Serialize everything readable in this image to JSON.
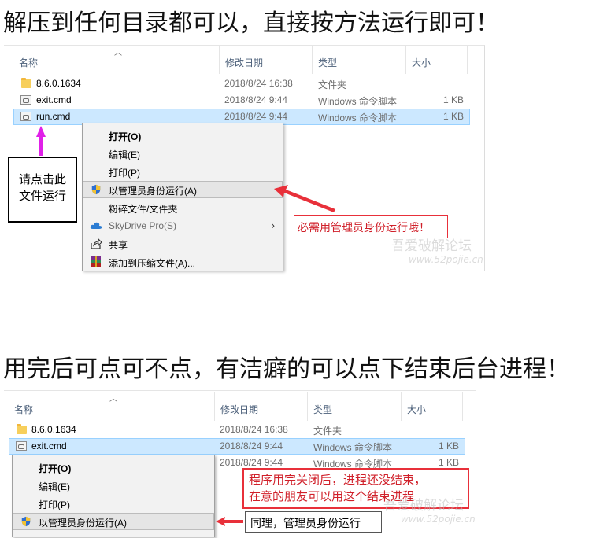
{
  "headings": {
    "top": "解压到任何目录都可以，直接按方法运行即可！",
    "bottom": "用完后可点可不点，有洁癖的可以点下结束后台进程！"
  },
  "columns": {
    "name": "名称",
    "modified": "修改日期",
    "type": "类型",
    "size": "大小"
  },
  "files": [
    {
      "name": "8.6.0.1634",
      "modified": "2018/8/24 16:38",
      "type": "文件夹",
      "size": "",
      "icon": "folder-icon"
    },
    {
      "name": "exit.cmd",
      "modified": "2018/8/24 9:44",
      "type": "Windows 命令脚本",
      "size": "1 KB",
      "icon": "cmd-file-icon"
    },
    {
      "name": "run.cmd",
      "modified": "2018/8/24 9:44",
      "type": "Windows 命令脚本",
      "size": "1 KB",
      "icon": "cmd-file-icon"
    }
  ],
  "context_menu_top": {
    "items": [
      {
        "label": "打开(O)",
        "bold": true,
        "icon": ""
      },
      {
        "label": "编辑(E)",
        "icon": ""
      },
      {
        "label": "打印(P)",
        "icon": ""
      },
      {
        "label": "以管理员身份运行(A)",
        "icon": "uac-shield-icon",
        "highlighted": true
      },
      {
        "label": "粉碎文件/文件夹",
        "icon": ""
      },
      {
        "label": "SkyDrive Pro(S)",
        "icon": "cloud-icon",
        "disabled": true,
        "submenu": true
      },
      {
        "label": "共享",
        "icon": "share-icon"
      },
      {
        "label": "添加到压缩文件(A)...",
        "icon": "winrar-icon"
      }
    ]
  },
  "context_menu_bottom": {
    "items": [
      {
        "label": "打开(O)",
        "bold": true
      },
      {
        "label": "编辑(E)"
      },
      {
        "label": "打印(P)"
      },
      {
        "label": "以管理员身份运行(A)",
        "icon": "uac-shield-icon",
        "highlighted": true
      }
    ]
  },
  "annotations": {
    "click_here_line1": "请点击此",
    "click_here_line2": "文件运行",
    "must_admin": "必需用管理员身份运行哦！",
    "close_line1": "程序用完关闭后，进程还没结束，",
    "close_line2": "在意的朋友可以用这个结束进程",
    "same_admin": "同理，管理员身份运行"
  },
  "watermark": {
    "title": "吾爱破解论坛",
    "url": "www.52pojie.cn"
  },
  "colors": {
    "selection": "#cce8ff",
    "selection_border": "#99d1ff",
    "annotation_red": "#e8303a",
    "arrow_magenta": "#e020e8",
    "header_text": "#4c607a"
  }
}
